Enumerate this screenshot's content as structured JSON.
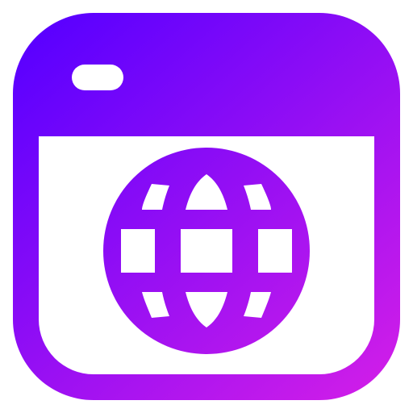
{
  "icon": {
    "name": "browser-globe-icon",
    "parts": [
      "browser-window-icon",
      "globe-icon"
    ]
  },
  "colors": {
    "gradient_start": "#5a00ff",
    "gradient_end": "#d21ee8",
    "background": "#ffffff"
  }
}
